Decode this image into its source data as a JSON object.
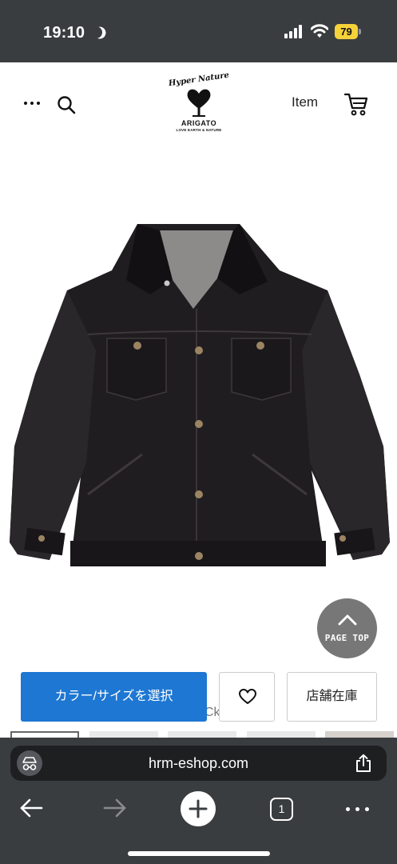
{
  "status_bar": {
    "time": "19:10",
    "battery": "79",
    "icons": [
      "moon-icon",
      "signal-icon",
      "wifi-icon",
      "battery-icon"
    ]
  },
  "header": {
    "logo_top": "Hyper Nature",
    "logo_name": "ARIGATO",
    "logo_tagline": "LOVE EARTH & NATURE",
    "item_link": "Item",
    "icons": [
      "menu-dots-icon",
      "search-icon",
      "cart-icon"
    ]
  },
  "product": {
    "image_alt": "black denim jacket",
    "page_top_label": "PAGE TOP",
    "peek_text": "Ck"
  },
  "actions": {
    "select_label": "カラー/サイズを選択",
    "store_stock_label": "店舗在庫",
    "accent_color": "#1e77d2",
    "icons": [
      "heart-icon"
    ]
  },
  "browser": {
    "url": "hrm-eshop.com",
    "tab_count": "1",
    "icons": [
      "incognito-icon",
      "share-icon",
      "back-arrow-icon",
      "forward-arrow-icon",
      "plus-icon",
      "tabs-icon",
      "more-dots-icon"
    ]
  }
}
